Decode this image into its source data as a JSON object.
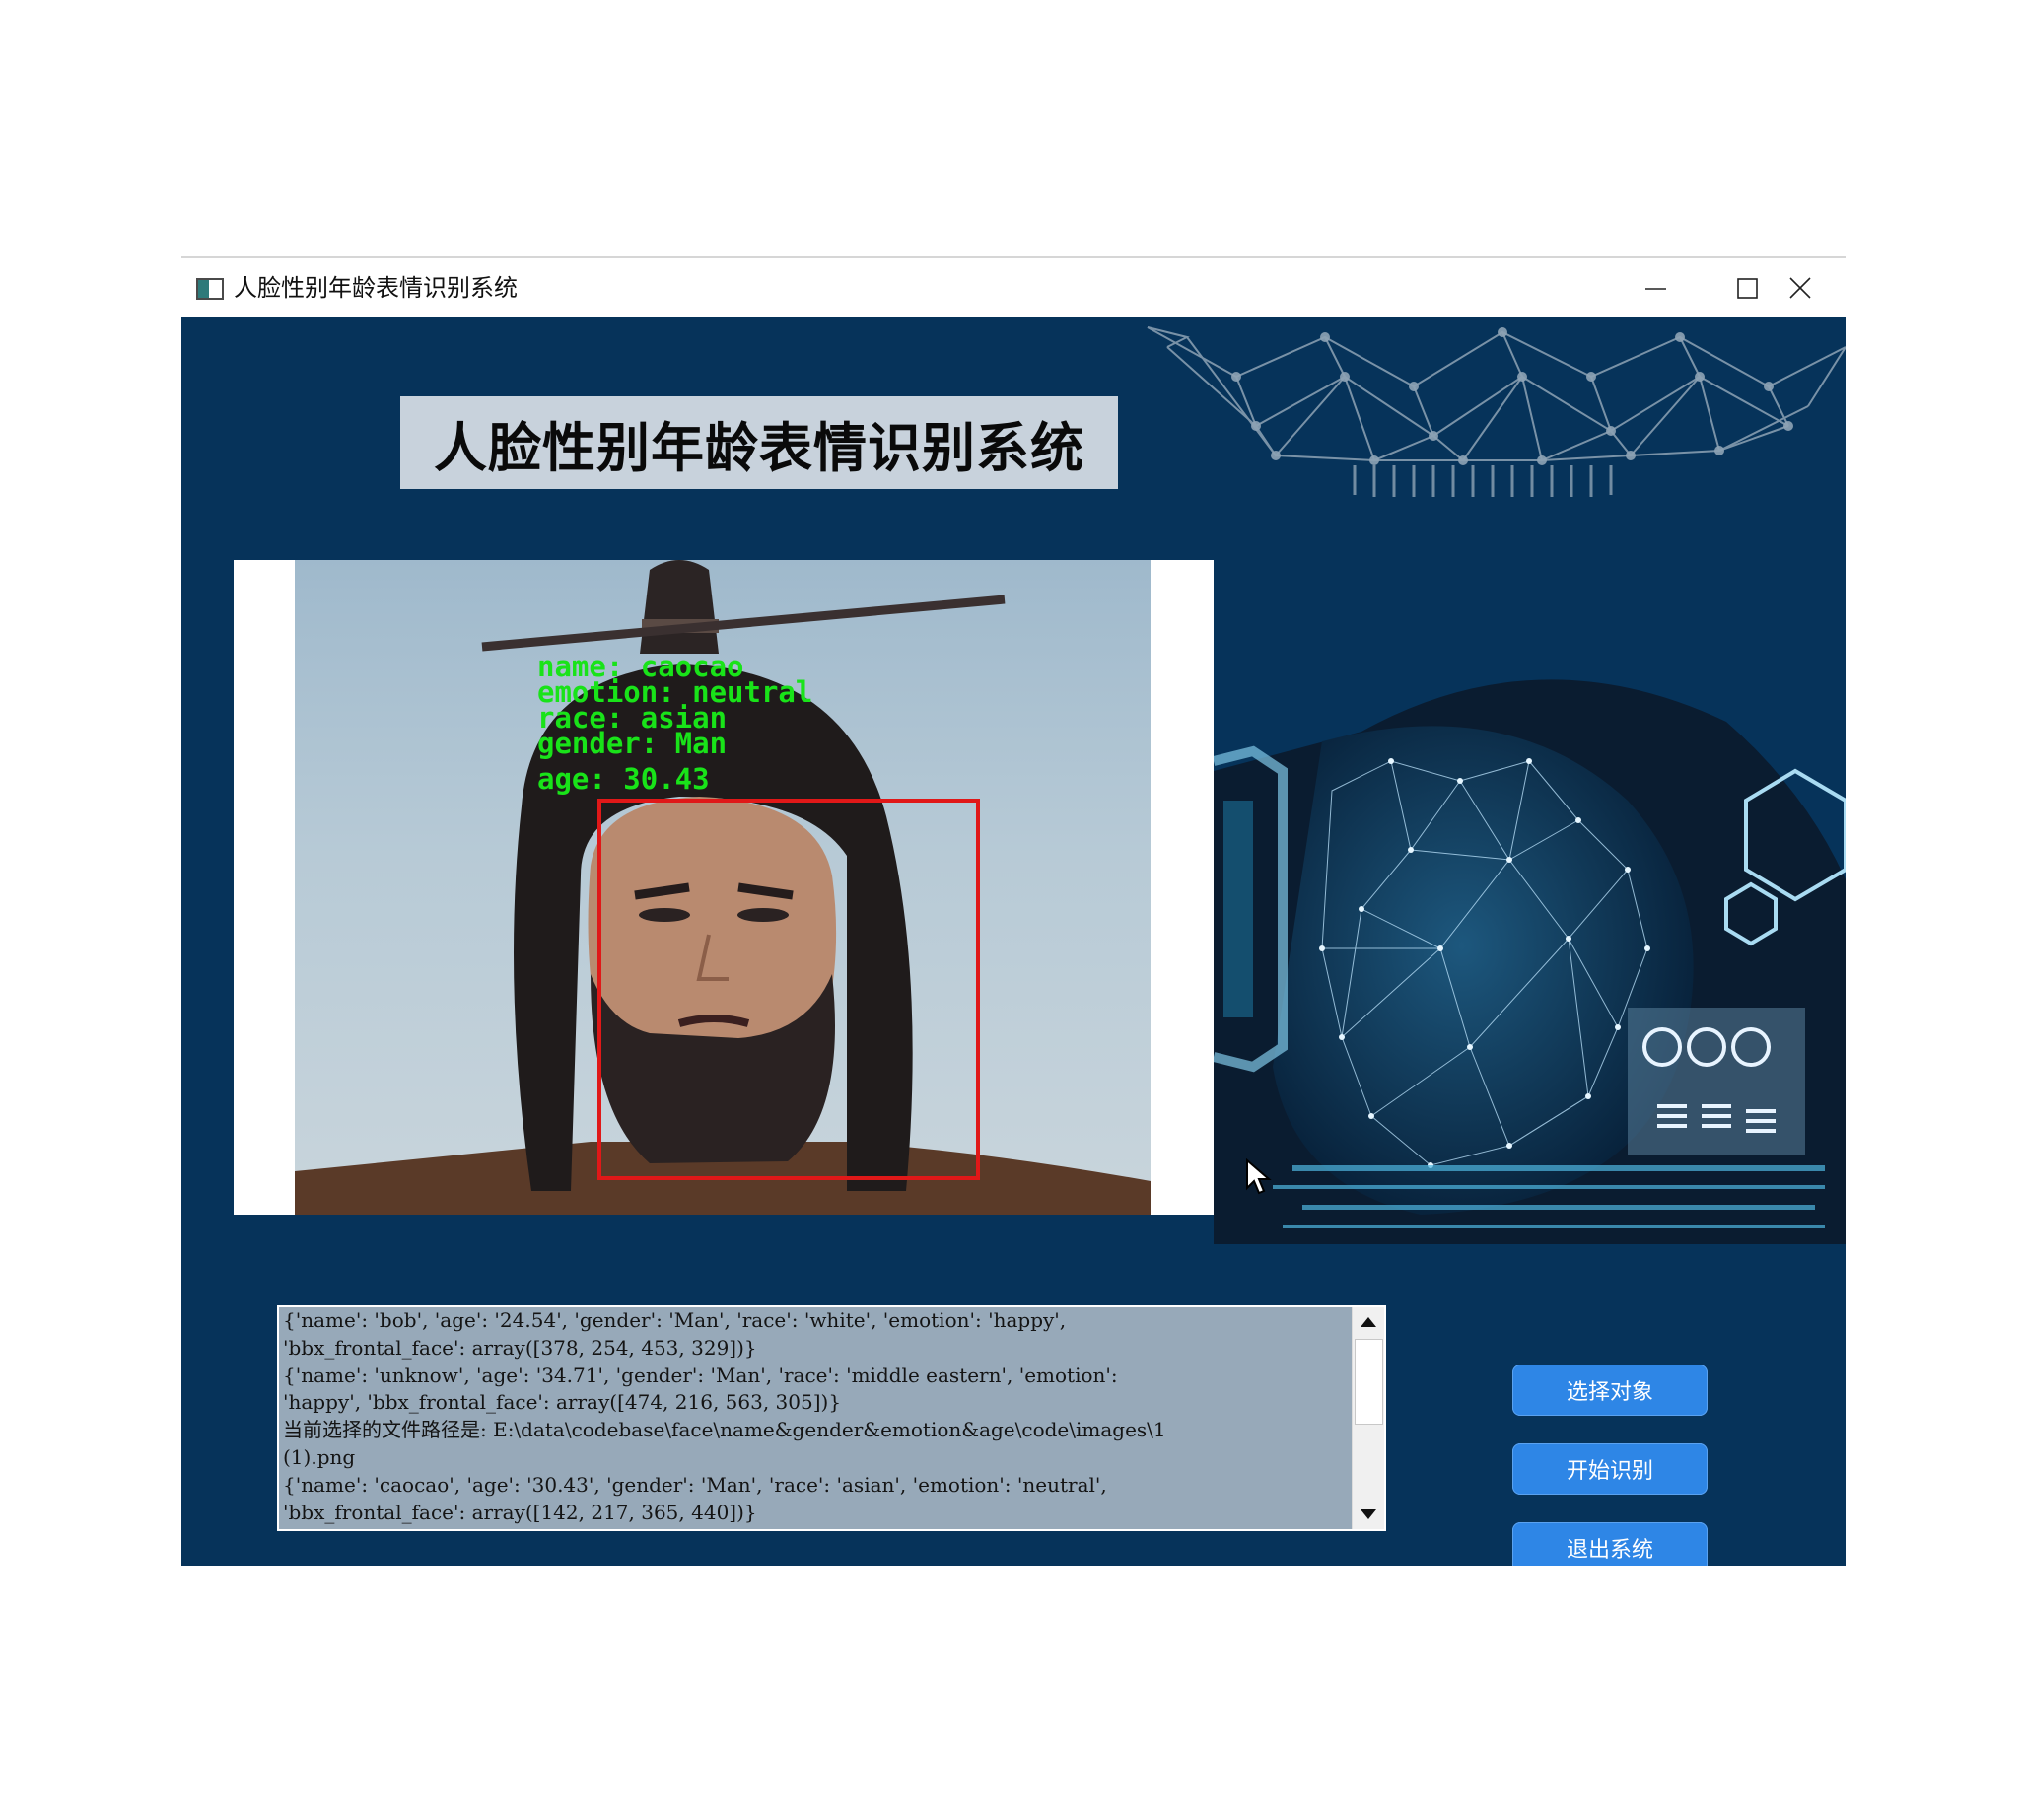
{
  "window": {
    "title": "人脸性别年龄表情识别系统"
  },
  "header": {
    "title": "人脸性别年龄表情识别系统"
  },
  "photo": {
    "labels": [
      "name: caocao",
      "emotion: neutral",
      "race: asian",
      "gender: Man",
      "age: 30.43"
    ],
    "label_color": "#19e319",
    "box_color": "#e01818"
  },
  "log": {
    "lines": [
      "{'name': 'bob', 'age': '24.54', 'gender': 'Man', 'race': 'white', 'emotion': 'happy',",
      "'bbx_frontal_face': array([378, 254, 453, 329])}",
      "{'name': 'unknow', 'age': '34.71', 'gender': 'Man', 'race': 'middle eastern', 'emotion':",
      "'happy', 'bbx_frontal_face': array([474, 216, 563, 305])}",
      "当前选择的文件路径是: E:\\data\\codebase\\face\\name&gender&emotion&age\\code\\images\\1",
      "(1).png",
      "{'name': 'caocao', 'age': '30.43', 'gender': 'Man', 'race': 'asian', 'emotion': 'neutral',",
      "'bbx_frontal_face': array([142, 217, 365, 440])}"
    ]
  },
  "buttons": {
    "select_label": "选择对象",
    "start_label": "开始识别",
    "exit_label": "退出系统"
  },
  "colors": {
    "background": "#06335a",
    "button": "#2e86e6",
    "title_panel": "#c8d2dc",
    "log_background": "#97a9b9"
  }
}
